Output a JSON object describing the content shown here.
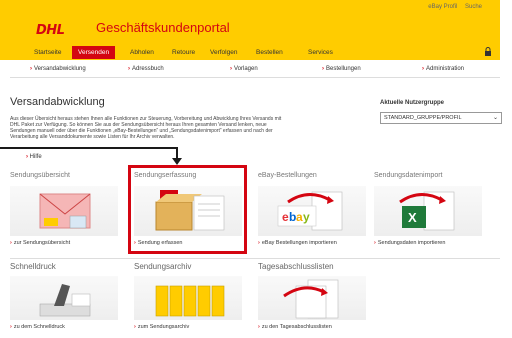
{
  "header": {
    "logo": "DHL",
    "title": "Geschäftskundenportal",
    "links": [
      "eBay Profil",
      "Suche"
    ]
  },
  "nav": {
    "tabs": [
      "Startseite",
      "Versenden",
      "Abholen",
      "Retoure",
      "Verfolgen",
      "Bestellen",
      "Services"
    ],
    "active": "Versenden"
  },
  "subnav": [
    "Versandabwicklung",
    "Adressbuch",
    "Vorlagen",
    "Bestellungen",
    "Administration"
  ],
  "page": {
    "title": "Versandabwicklung",
    "intro_1": "Aus dieser Übersicht heraus stehen Ihnen alle Funktionen zur Steuerung, Vorbereitung und Abwicklung Ihres Versands mit",
    "intro_2": "DHL Paket zur Verfügung. So können Sie aus der Sendungsübersicht heraus Ihren gesamten Versand lenken, neue",
    "intro_3": "Sendungen manuell oder über die Funktionen „eBay-Bestellungen“ und „Sendungsdatenimport“ erfassen und nach der",
    "intro_4": "Verarbeitung alle Versanddokumente sowie Listen für Ihr Archiv verwalten.",
    "help": "Hilfe"
  },
  "user_group": {
    "label": "Aktuelle Nutzergruppe",
    "selected": "STANDARD_GRUPPE/PROFIL"
  },
  "tiles": [
    {
      "title": "Sendungsübersicht",
      "link": "zur Sendungsübersicht"
    },
    {
      "title": "Sendungserfassung",
      "link": "Sendung erfassen"
    },
    {
      "title": "eBay-Bestellungen",
      "link": "eBay Bestellungen importieren"
    },
    {
      "title": "Sendungsdatenimport",
      "link": "Sendungsdaten importieren"
    },
    {
      "title": "Schnelldruck",
      "link": "zu dem Schnelldruck"
    },
    {
      "title": "Sendungsarchiv",
      "link": "zum Sendungsarchiv"
    },
    {
      "title": "Tagesabschlusslisten",
      "link": "zu den Tagesabschlusslisten"
    }
  ],
  "colors": {
    "brand_yellow": "#ffcc00",
    "brand_red": "#d40511",
    "callout": "#1a1a1a"
  }
}
